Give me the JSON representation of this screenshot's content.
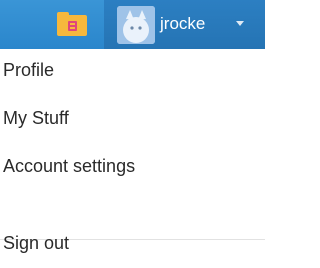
{
  "header": {
    "stuff_icon": "folder-stuff-icon",
    "user": {
      "avatar_icon": "user-avatar",
      "username": "jrocke",
      "dropdown_icon": "caret-down-icon"
    }
  },
  "menu": {
    "items": [
      {
        "label": "Profile"
      },
      {
        "label": "My Stuff"
      },
      {
        "label": "Account settings"
      },
      {
        "label": "Sign out"
      }
    ]
  },
  "colors": {
    "topbar": "#2a86cc",
    "folder": "#f6b83d",
    "folder_mark": "#e0457b",
    "menu_text": "#2a2a2a"
  }
}
